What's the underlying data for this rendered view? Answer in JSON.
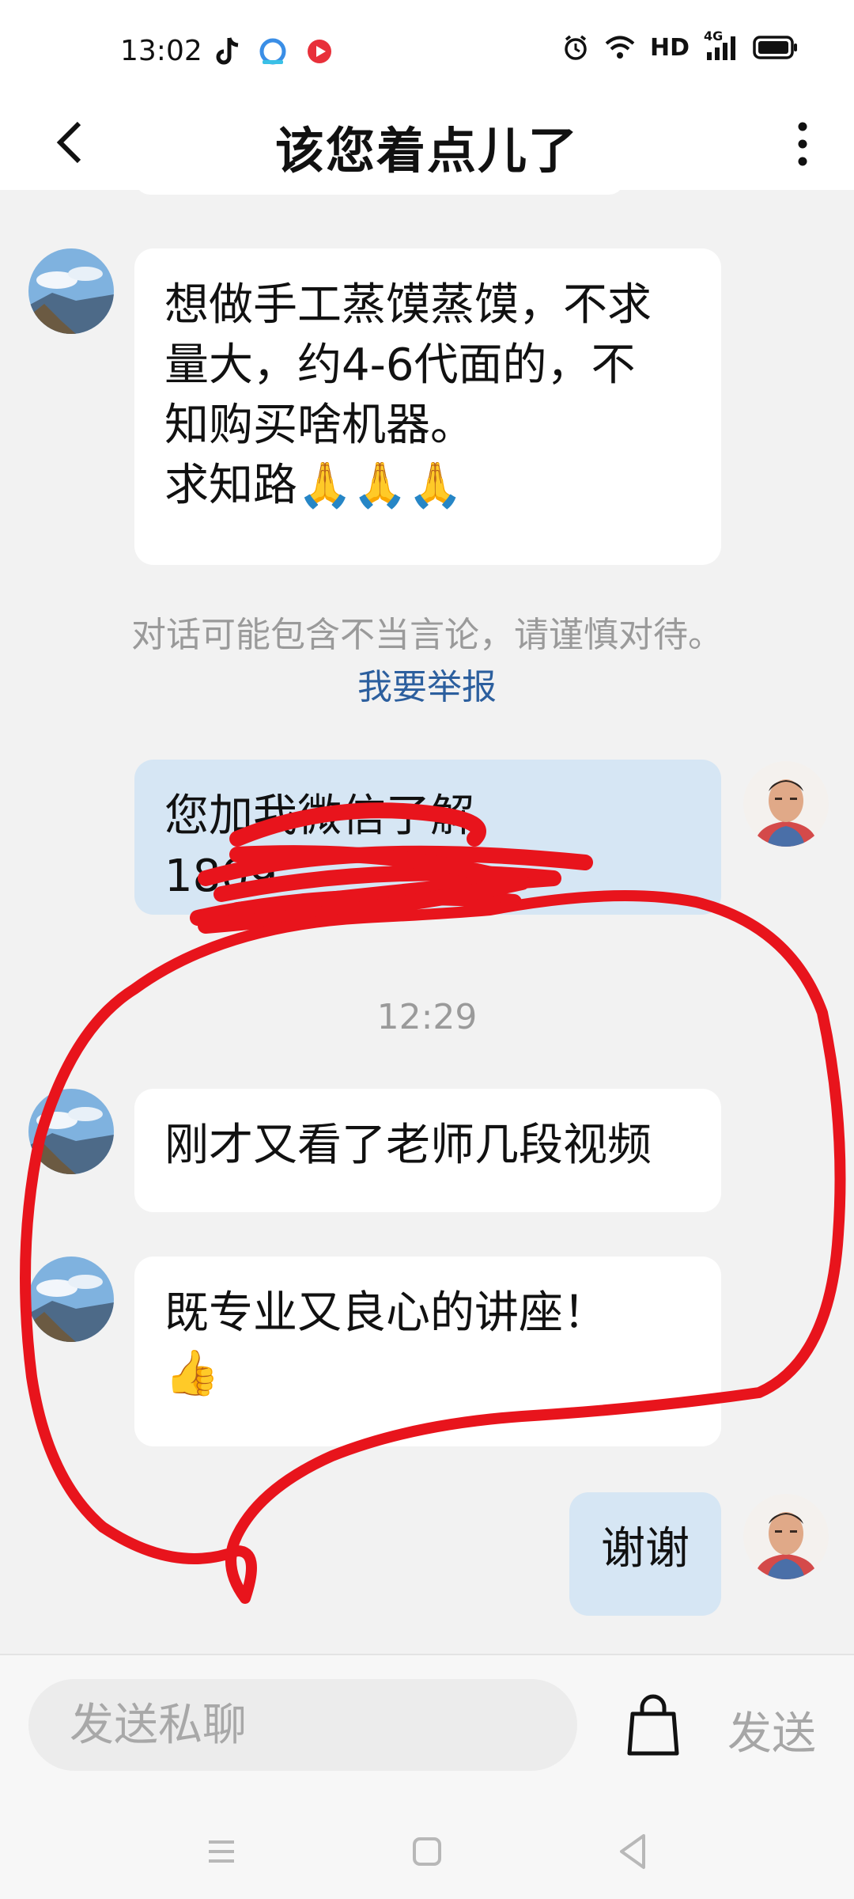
{
  "status_bar": {
    "time": "13:02",
    "network": "HD",
    "signal_label": "4G"
  },
  "header": {
    "title": "该您着点儿了"
  },
  "messages": [
    {
      "side": "in",
      "text": "想做手工蒸馍蒸馍，不求\n量大，约4-6代面的，不\n知购买啥机器。\n求知路🙏🙏🙏"
    },
    {
      "side": "out",
      "text": "您加我微信了解\n1809"
    },
    {
      "side": "in",
      "text": "刚才又看了老师几段视频"
    },
    {
      "side": "in",
      "text": "既专业又良心的讲座！\n👍"
    },
    {
      "side": "out",
      "text": "谢谢"
    }
  ],
  "notice": {
    "text": "对话可能包含不当言论，请谨慎对待。",
    "link": "我要举报"
  },
  "timestamp": "12:29",
  "input": {
    "placeholder": "发送私聊",
    "send_label": "发送"
  },
  "colors": {
    "incoming_bubble": "#ffffff",
    "outgoing_bubble": "#d6e6f4",
    "annotation_red": "#e8141c",
    "link": "#2c5f9e"
  }
}
